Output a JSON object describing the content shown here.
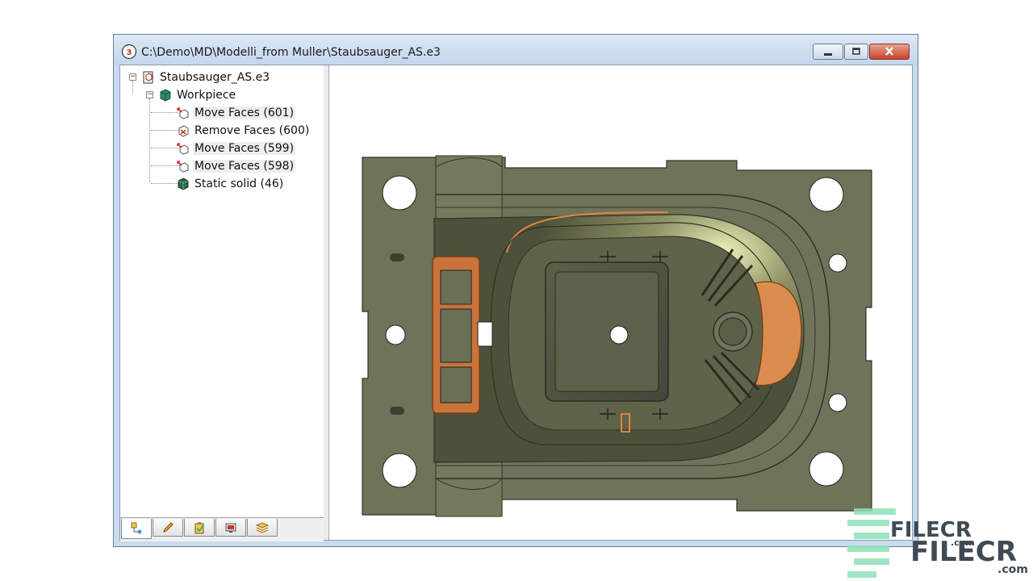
{
  "window": {
    "title": "C:\\Demo\\MD\\Modelli_from Muller\\Staubsauger_AS.e3",
    "controls": [
      "minimize-icon",
      "maximize-icon",
      "close-icon"
    ]
  },
  "tree": {
    "root": {
      "label": "Staubsauger_AS.e3",
      "icon": "document-3d-icon"
    },
    "workpiece": {
      "label": "Workpiece",
      "icon": "cube-icon"
    },
    "features": [
      {
        "label": "Move Faces (601)",
        "icon": "move-faces-icon"
      },
      {
        "label": "Remove Faces (600)",
        "icon": "remove-faces-icon"
      },
      {
        "label": "Move Faces (599)",
        "icon": "move-faces-icon"
      },
      {
        "label": "Move Faces (598)",
        "icon": "move-faces-icon"
      },
      {
        "label": "Static solid (46)",
        "icon": "static-solid-icon"
      }
    ]
  },
  "tabs": [
    {
      "icon": "tree-view-icon",
      "active": true
    },
    {
      "icon": "pencil-icon",
      "active": false
    },
    {
      "icon": "clipboard-icon",
      "active": false
    },
    {
      "icon": "display-icon",
      "active": false
    },
    {
      "icon": "layers-icon",
      "active": false
    }
  ],
  "viewport": {
    "content": "mold-cavity-3d-model"
  },
  "watermark": {
    "brand": "FILECR",
    "suffix": ".com"
  },
  "colors": {
    "model_body": "#6b6f55",
    "highlight_orange": "#e0863f",
    "title_bar": "#c9dbee"
  }
}
